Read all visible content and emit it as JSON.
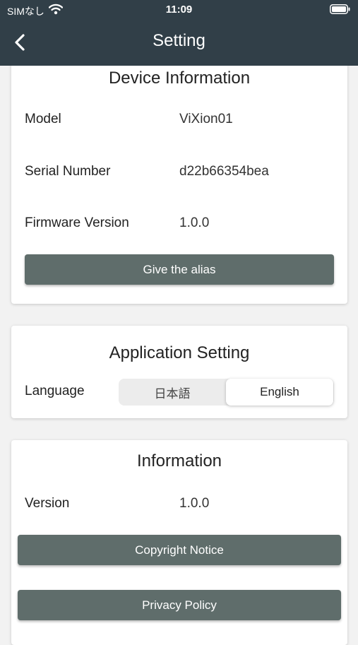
{
  "status_bar": {
    "carrier": "SIMなし",
    "time": "11:09"
  },
  "nav": {
    "title": "Setting"
  },
  "device_info": {
    "title": "Device Information",
    "rows": [
      {
        "label": "Model",
        "value": "ViXion01"
      },
      {
        "label": "Serial Number",
        "value": "d22b66354bea"
      },
      {
        "label": "Firmware Version",
        "value": "1.0.0"
      }
    ],
    "alias_button": "Give the alias"
  },
  "app_setting": {
    "title": "Application Setting",
    "language_label": "Language",
    "options": [
      "日本語",
      "English"
    ],
    "selected": "English"
  },
  "information": {
    "title": "Information",
    "version_label": "Version",
    "version_value": "1.0.0",
    "copyright_button": "Copyright Notice",
    "privacy_button": "Privacy Policy"
  },
  "colors": {
    "header": "#313f48",
    "button": "#5f6d6b",
    "background": "#f2f2f2"
  }
}
